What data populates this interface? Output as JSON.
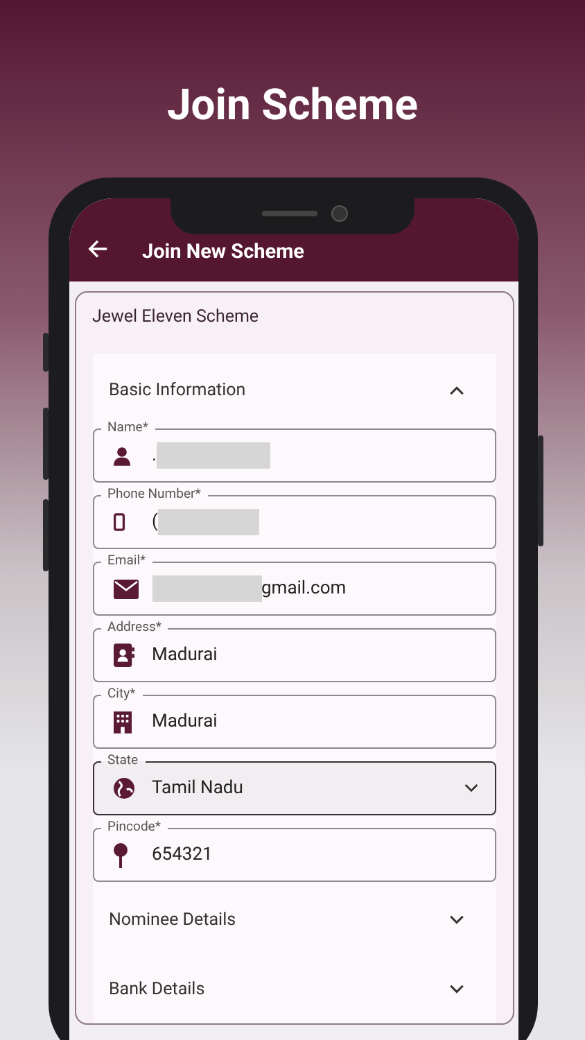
{
  "headline": "Join Scheme",
  "app_bar": {
    "title": "Join New Scheme"
  },
  "scheme_name": "Jewel Eleven Scheme",
  "sections": [
    {
      "title": "Basic Information",
      "expanded": true,
      "fields": [
        {
          "kind": "text",
          "label": "Name*",
          "value": ".",
          "redacted": true
        },
        {
          "kind": "text",
          "label": "Phone Number*",
          "value": "(",
          "redacted": true
        },
        {
          "kind": "text",
          "label": "Email*",
          "value": "gmail.com",
          "redacted": true
        },
        {
          "kind": "text",
          "label": "Address*",
          "value": "Madurai",
          "redacted": false
        },
        {
          "kind": "text",
          "label": "City*",
          "value": "Madurai",
          "redacted": false
        },
        {
          "kind": "select",
          "label": "State",
          "value": "Tamil Nadu",
          "redacted": false
        },
        {
          "kind": "text",
          "label": "Pincode*",
          "value": "654321",
          "redacted": false
        }
      ]
    },
    {
      "title": "Nominee Details",
      "expanded": false
    },
    {
      "title": "Bank Details",
      "expanded": false
    }
  ]
}
